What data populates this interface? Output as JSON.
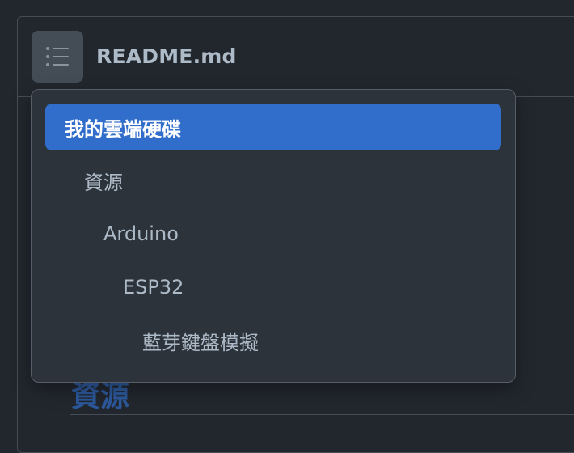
{
  "header": {
    "file_name": "README.md"
  },
  "toc": {
    "items": [
      {
        "label": "我的雲端硬碟",
        "level": 1,
        "active": true
      },
      {
        "label": "資源",
        "level": 2,
        "active": false
      },
      {
        "label": "Arduino",
        "level": 3,
        "active": false
      },
      {
        "label": "ESP32",
        "level": 4,
        "active": false
      },
      {
        "label": "藍芽鍵盤模擬",
        "level": 5,
        "active": false
      }
    ]
  },
  "content": {
    "heading": "資源"
  },
  "colors": {
    "accent": "#316dca",
    "background": "#22272e",
    "surface": "#2d333b",
    "text": "#adbac7"
  },
  "icons": {
    "toc_button": "list-unordered-icon"
  }
}
